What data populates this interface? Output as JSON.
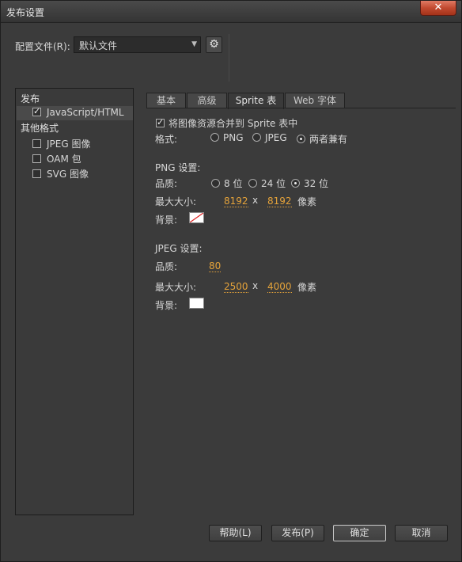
{
  "window": {
    "title": "发布设置",
    "close_label": "✕"
  },
  "profile": {
    "label": "配置文件(R):",
    "selected": "默认文件",
    "gear_icon": "gear-icon"
  },
  "tree": {
    "publish_header": "发布",
    "publish_items": [
      {
        "label": "JavaScript/HTML",
        "checked": true
      }
    ],
    "other_header": "其他格式",
    "other_items": [
      {
        "label": "JPEG 图像",
        "checked": false
      },
      {
        "label": "OAM 包",
        "checked": false
      },
      {
        "label": "SVG 图像",
        "checked": false
      }
    ]
  },
  "tabs": [
    {
      "label": "基本",
      "active": false
    },
    {
      "label": "高级",
      "active": false
    },
    {
      "label": "Sprite 表",
      "active": true
    },
    {
      "label": "Web 字体",
      "active": false
    }
  ],
  "sprite": {
    "merge_label": "将图像资源合并到 Sprite 表中",
    "merge_checked": true,
    "format_label": "格式:",
    "format_options": [
      "PNG",
      "JPEG",
      "两者兼有"
    ],
    "format_selected": "两者兼有",
    "png_header": "PNG 设置:",
    "quality_label": "品质:",
    "png_quality_options": [
      "8 位",
      "24 位",
      "32 位"
    ],
    "png_quality_selected": "32 位",
    "max_size_label": "最大大小:",
    "png_width": "8192",
    "png_height": "8192",
    "times": "x",
    "pixels_label": "像素",
    "bg_label": "背景:",
    "jpeg_header": "JPEG 设置:",
    "jpeg_quality": "80",
    "jpeg_width": "2500",
    "jpeg_height": "4000"
  },
  "buttons": {
    "help": "帮助(L)",
    "publish": "发布(P)",
    "ok": "确定",
    "cancel": "取消"
  },
  "colors": {
    "accent_value": "#e5a33a",
    "close_red": "#c24a30"
  }
}
